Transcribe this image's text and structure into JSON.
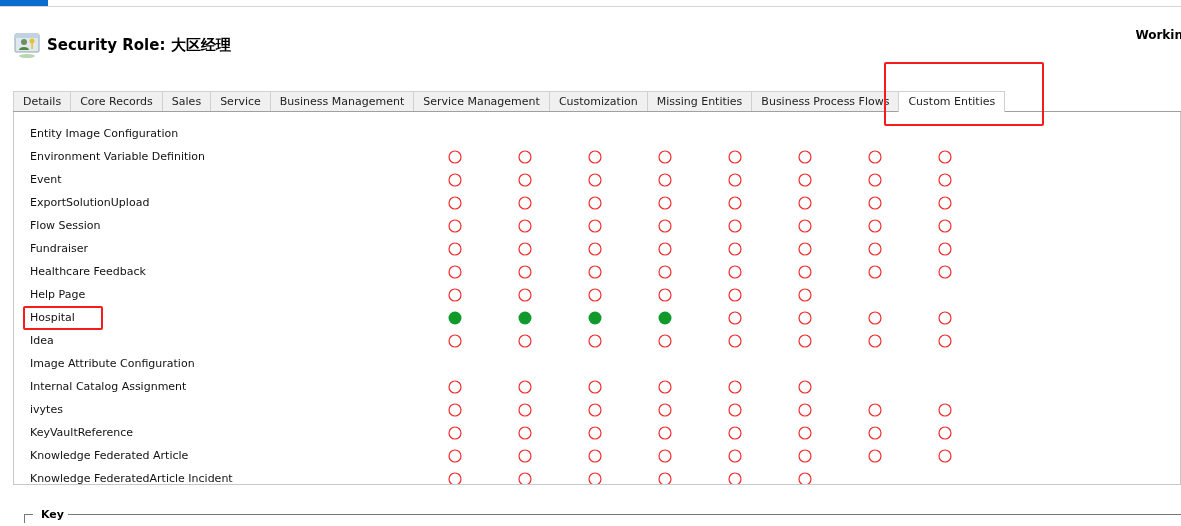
{
  "header": {
    "title": "Security Role: 大区经理",
    "status": "Workin"
  },
  "tabs": [
    {
      "label": "Details",
      "selected": false,
      "annotated": false
    },
    {
      "label": "Core Records",
      "selected": false,
      "annotated": false
    },
    {
      "label": "Sales",
      "selected": false,
      "annotated": false
    },
    {
      "label": "Service",
      "selected": false,
      "annotated": false
    },
    {
      "label": "Business Management",
      "selected": false,
      "annotated": false
    },
    {
      "label": "Service Management",
      "selected": false,
      "annotated": false
    },
    {
      "label": "Customization",
      "selected": false,
      "annotated": false
    },
    {
      "label": "Missing Entities",
      "selected": false,
      "annotated": false
    },
    {
      "label": "Business Process Flows",
      "selected": false,
      "annotated": false
    },
    {
      "label": "Custom Entities",
      "selected": true,
      "annotated": true
    }
  ],
  "rows": [
    {
      "name": "Entity Image Configuration",
      "annotated": false,
      "cells": [
        {
          "kind": "blank"
        },
        {
          "kind": "blank"
        },
        {
          "kind": "blank"
        },
        {
          "kind": "blank"
        },
        {
          "kind": "blank"
        },
        {
          "kind": "blank"
        },
        {
          "kind": "blank"
        },
        {
          "kind": "blank"
        }
      ]
    },
    {
      "name": "Environment Variable Definition",
      "annotated": false,
      "cells": [
        {
          "kind": "ring"
        },
        {
          "kind": "ring"
        },
        {
          "kind": "ring"
        },
        {
          "kind": "ring"
        },
        {
          "kind": "ring"
        },
        {
          "kind": "ring"
        },
        {
          "kind": "ring"
        },
        {
          "kind": "ring"
        }
      ]
    },
    {
      "name": "Event",
      "annotated": false,
      "cells": [
        {
          "kind": "ring"
        },
        {
          "kind": "ring"
        },
        {
          "kind": "ring"
        },
        {
          "kind": "ring"
        },
        {
          "kind": "ring"
        },
        {
          "kind": "ring"
        },
        {
          "kind": "ring"
        },
        {
          "kind": "ring"
        }
      ]
    },
    {
      "name": "ExportSolutionUpload",
      "annotated": false,
      "cells": [
        {
          "kind": "ring"
        },
        {
          "kind": "ring"
        },
        {
          "kind": "ring"
        },
        {
          "kind": "ring"
        },
        {
          "kind": "ring"
        },
        {
          "kind": "ring"
        },
        {
          "kind": "ring"
        },
        {
          "kind": "ring"
        }
      ]
    },
    {
      "name": "Flow Session",
      "annotated": false,
      "cells": [
        {
          "kind": "ring"
        },
        {
          "kind": "ring"
        },
        {
          "kind": "ring"
        },
        {
          "kind": "ring"
        },
        {
          "kind": "ring"
        },
        {
          "kind": "ring"
        },
        {
          "kind": "ring"
        },
        {
          "kind": "ring"
        }
      ]
    },
    {
      "name": "Fundraiser",
      "annotated": false,
      "cells": [
        {
          "kind": "ring"
        },
        {
          "kind": "ring"
        },
        {
          "kind": "ring"
        },
        {
          "kind": "ring"
        },
        {
          "kind": "ring"
        },
        {
          "kind": "ring"
        },
        {
          "kind": "ring"
        },
        {
          "kind": "ring"
        }
      ]
    },
    {
      "name": "Healthcare Feedback",
      "annotated": false,
      "cells": [
        {
          "kind": "ring"
        },
        {
          "kind": "ring"
        },
        {
          "kind": "ring"
        },
        {
          "kind": "ring"
        },
        {
          "kind": "ring"
        },
        {
          "kind": "ring"
        },
        {
          "kind": "ring"
        },
        {
          "kind": "ring"
        }
      ]
    },
    {
      "name": "Help Page",
      "annotated": false,
      "cells": [
        {
          "kind": "ring"
        },
        {
          "kind": "ring"
        },
        {
          "kind": "ring"
        },
        {
          "kind": "ring"
        },
        {
          "kind": "ring"
        },
        {
          "kind": "ring"
        },
        {
          "kind": "blank"
        },
        {
          "kind": "blank"
        }
      ]
    },
    {
      "name": "Hospital",
      "annotated": true,
      "cells": [
        {
          "kind": "dot"
        },
        {
          "kind": "dot"
        },
        {
          "kind": "dot"
        },
        {
          "kind": "dot"
        },
        {
          "kind": "ring"
        },
        {
          "kind": "ring"
        },
        {
          "kind": "ring"
        },
        {
          "kind": "ring"
        }
      ]
    },
    {
      "name": "Idea",
      "annotated": false,
      "cells": [
        {
          "kind": "ring"
        },
        {
          "kind": "ring"
        },
        {
          "kind": "ring"
        },
        {
          "kind": "ring"
        },
        {
          "kind": "ring"
        },
        {
          "kind": "ring"
        },
        {
          "kind": "ring"
        },
        {
          "kind": "ring"
        }
      ]
    },
    {
      "name": "Image Attribute Configuration",
      "annotated": false,
      "cells": [
        {
          "kind": "blank"
        },
        {
          "kind": "blank"
        },
        {
          "kind": "blank"
        },
        {
          "kind": "blank"
        },
        {
          "kind": "blank"
        },
        {
          "kind": "blank"
        },
        {
          "kind": "blank"
        },
        {
          "kind": "blank"
        }
      ]
    },
    {
      "name": "Internal Catalog Assignment",
      "annotated": false,
      "cells": [
        {
          "kind": "ring"
        },
        {
          "kind": "ring"
        },
        {
          "kind": "ring"
        },
        {
          "kind": "ring"
        },
        {
          "kind": "ring"
        },
        {
          "kind": "ring"
        },
        {
          "kind": "blank"
        },
        {
          "kind": "blank"
        }
      ]
    },
    {
      "name": "ivytes",
      "annotated": false,
      "cells": [
        {
          "kind": "ring"
        },
        {
          "kind": "ring"
        },
        {
          "kind": "ring"
        },
        {
          "kind": "ring"
        },
        {
          "kind": "ring"
        },
        {
          "kind": "ring"
        },
        {
          "kind": "ring"
        },
        {
          "kind": "ring"
        }
      ]
    },
    {
      "name": "KeyVaultReference",
      "annotated": false,
      "cells": [
        {
          "kind": "ring"
        },
        {
          "kind": "ring"
        },
        {
          "kind": "ring"
        },
        {
          "kind": "ring"
        },
        {
          "kind": "ring"
        },
        {
          "kind": "ring"
        },
        {
          "kind": "ring"
        },
        {
          "kind": "ring"
        }
      ]
    },
    {
      "name": "Knowledge Federated Article",
      "annotated": false,
      "cells": [
        {
          "kind": "ring"
        },
        {
          "kind": "ring"
        },
        {
          "kind": "ring"
        },
        {
          "kind": "ring"
        },
        {
          "kind": "ring"
        },
        {
          "kind": "ring"
        },
        {
          "kind": "ring"
        },
        {
          "kind": "ring"
        }
      ]
    },
    {
      "name": "Knowledge FederatedArticle Incident",
      "annotated": false,
      "cells": [
        {
          "kind": "ring"
        },
        {
          "kind": "ring"
        },
        {
          "kind": "ring"
        },
        {
          "kind": "ring"
        },
        {
          "kind": "ring"
        },
        {
          "kind": "ring"
        },
        {
          "kind": "blank"
        },
        {
          "kind": "blank"
        }
      ]
    }
  ],
  "key": {
    "title": "Key"
  }
}
